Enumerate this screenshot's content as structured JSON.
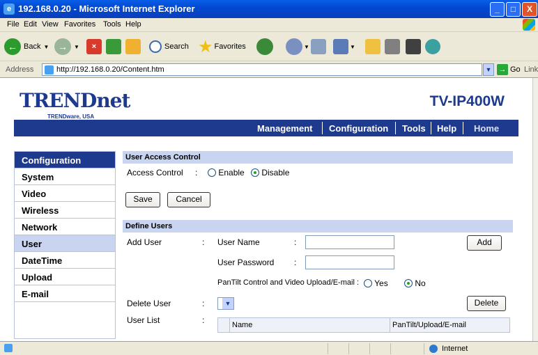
{
  "window": {
    "title": "192.168.0.20 - Microsoft Internet Explorer"
  },
  "menu": [
    "File",
    "Edit",
    "View",
    "Favorites",
    "Tools",
    "Help"
  ],
  "toolbar": {
    "back": "Back",
    "search": "Search",
    "favorites": "Favorites"
  },
  "address": {
    "label": "Address",
    "url": "http://192.168.0.20/Content.htm",
    "go": "Go",
    "links": "Links"
  },
  "header": {
    "brand": "TRENDnet",
    "brand_sub": "TRENDware, USA",
    "model": "TV-IP400W"
  },
  "nav": [
    "Management",
    "Configuration",
    "Tools",
    "Help",
    "Home"
  ],
  "sidebar": {
    "title": "Configuration",
    "items": [
      "System",
      "Video",
      "Wireless",
      "Network",
      "User",
      "DateTime",
      "Upload",
      "E-mail"
    ],
    "active": "User"
  },
  "access": {
    "section": "User Access Control",
    "label": "Access Control",
    "colon": ":",
    "enable": "Enable",
    "disable": "Disable",
    "selected": "Disable",
    "save": "Save",
    "cancel": "Cancel"
  },
  "define": {
    "section": "Define Users",
    "add_user": "Add User",
    "user_name": "User Name",
    "user_password": "User Password",
    "pantilt": "PanTilt Control and Video Upload/E-mail :",
    "yes": "Yes",
    "no": "No",
    "pantilt_selected": "No",
    "add_button": "Add",
    "delete_user": "Delete User",
    "delete_button": "Delete",
    "user_list": "User List",
    "col_name": "Name",
    "col_perm": "PanTilt/Upload/E-mail"
  },
  "status": {
    "zone": "Internet"
  },
  "colors": {
    "brand_blue": "#1d3a8f",
    "section_bg": "#c8d4f0"
  }
}
